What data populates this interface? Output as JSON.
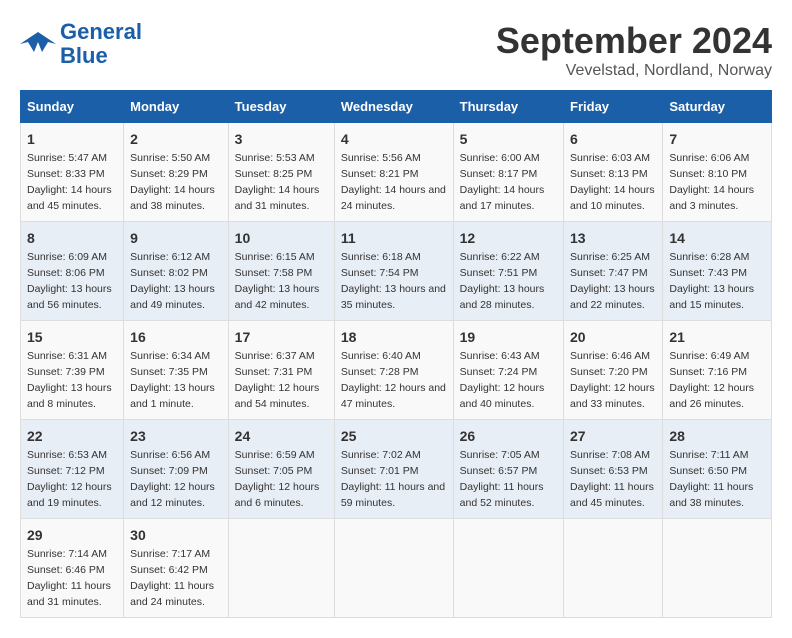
{
  "header": {
    "logo_general": "General",
    "logo_blue": "Blue",
    "month_title": "September 2024",
    "location": "Vevelstad, Nordland, Norway"
  },
  "columns": [
    "Sunday",
    "Monday",
    "Tuesday",
    "Wednesday",
    "Thursday",
    "Friday",
    "Saturday"
  ],
  "weeks": [
    [
      {
        "day": "1",
        "sunrise": "Sunrise: 5:47 AM",
        "sunset": "Sunset: 8:33 PM",
        "daylight": "Daylight: 14 hours and 45 minutes."
      },
      {
        "day": "2",
        "sunrise": "Sunrise: 5:50 AM",
        "sunset": "Sunset: 8:29 PM",
        "daylight": "Daylight: 14 hours and 38 minutes."
      },
      {
        "day": "3",
        "sunrise": "Sunrise: 5:53 AM",
        "sunset": "Sunset: 8:25 PM",
        "daylight": "Daylight: 14 hours and 31 minutes."
      },
      {
        "day": "4",
        "sunrise": "Sunrise: 5:56 AM",
        "sunset": "Sunset: 8:21 PM",
        "daylight": "Daylight: 14 hours and 24 minutes."
      },
      {
        "day": "5",
        "sunrise": "Sunrise: 6:00 AM",
        "sunset": "Sunset: 8:17 PM",
        "daylight": "Daylight: 14 hours and 17 minutes."
      },
      {
        "day": "6",
        "sunrise": "Sunrise: 6:03 AM",
        "sunset": "Sunset: 8:13 PM",
        "daylight": "Daylight: 14 hours and 10 minutes."
      },
      {
        "day": "7",
        "sunrise": "Sunrise: 6:06 AM",
        "sunset": "Sunset: 8:10 PM",
        "daylight": "Daylight: 14 hours and 3 minutes."
      }
    ],
    [
      {
        "day": "8",
        "sunrise": "Sunrise: 6:09 AM",
        "sunset": "Sunset: 8:06 PM",
        "daylight": "Daylight: 13 hours and 56 minutes."
      },
      {
        "day": "9",
        "sunrise": "Sunrise: 6:12 AM",
        "sunset": "Sunset: 8:02 PM",
        "daylight": "Daylight: 13 hours and 49 minutes."
      },
      {
        "day": "10",
        "sunrise": "Sunrise: 6:15 AM",
        "sunset": "Sunset: 7:58 PM",
        "daylight": "Daylight: 13 hours and 42 minutes."
      },
      {
        "day": "11",
        "sunrise": "Sunrise: 6:18 AM",
        "sunset": "Sunset: 7:54 PM",
        "daylight": "Daylight: 13 hours and 35 minutes."
      },
      {
        "day": "12",
        "sunrise": "Sunrise: 6:22 AM",
        "sunset": "Sunset: 7:51 PM",
        "daylight": "Daylight: 13 hours and 28 minutes."
      },
      {
        "day": "13",
        "sunrise": "Sunrise: 6:25 AM",
        "sunset": "Sunset: 7:47 PM",
        "daylight": "Daylight: 13 hours and 22 minutes."
      },
      {
        "day": "14",
        "sunrise": "Sunrise: 6:28 AM",
        "sunset": "Sunset: 7:43 PM",
        "daylight": "Daylight: 13 hours and 15 minutes."
      }
    ],
    [
      {
        "day": "15",
        "sunrise": "Sunrise: 6:31 AM",
        "sunset": "Sunset: 7:39 PM",
        "daylight": "Daylight: 13 hours and 8 minutes."
      },
      {
        "day": "16",
        "sunrise": "Sunrise: 6:34 AM",
        "sunset": "Sunset: 7:35 PM",
        "daylight": "Daylight: 13 hours and 1 minute."
      },
      {
        "day": "17",
        "sunrise": "Sunrise: 6:37 AM",
        "sunset": "Sunset: 7:31 PM",
        "daylight": "Daylight: 12 hours and 54 minutes."
      },
      {
        "day": "18",
        "sunrise": "Sunrise: 6:40 AM",
        "sunset": "Sunset: 7:28 PM",
        "daylight": "Daylight: 12 hours and 47 minutes."
      },
      {
        "day": "19",
        "sunrise": "Sunrise: 6:43 AM",
        "sunset": "Sunset: 7:24 PM",
        "daylight": "Daylight: 12 hours and 40 minutes."
      },
      {
        "day": "20",
        "sunrise": "Sunrise: 6:46 AM",
        "sunset": "Sunset: 7:20 PM",
        "daylight": "Daylight: 12 hours and 33 minutes."
      },
      {
        "day": "21",
        "sunrise": "Sunrise: 6:49 AM",
        "sunset": "Sunset: 7:16 PM",
        "daylight": "Daylight: 12 hours and 26 minutes."
      }
    ],
    [
      {
        "day": "22",
        "sunrise": "Sunrise: 6:53 AM",
        "sunset": "Sunset: 7:12 PM",
        "daylight": "Daylight: 12 hours and 19 minutes."
      },
      {
        "day": "23",
        "sunrise": "Sunrise: 6:56 AM",
        "sunset": "Sunset: 7:09 PM",
        "daylight": "Daylight: 12 hours and 12 minutes."
      },
      {
        "day": "24",
        "sunrise": "Sunrise: 6:59 AM",
        "sunset": "Sunset: 7:05 PM",
        "daylight": "Daylight: 12 hours and 6 minutes."
      },
      {
        "day": "25",
        "sunrise": "Sunrise: 7:02 AM",
        "sunset": "Sunset: 7:01 PM",
        "daylight": "Daylight: 11 hours and 59 minutes."
      },
      {
        "day": "26",
        "sunrise": "Sunrise: 7:05 AM",
        "sunset": "Sunset: 6:57 PM",
        "daylight": "Daylight: 11 hours and 52 minutes."
      },
      {
        "day": "27",
        "sunrise": "Sunrise: 7:08 AM",
        "sunset": "Sunset: 6:53 PM",
        "daylight": "Daylight: 11 hours and 45 minutes."
      },
      {
        "day": "28",
        "sunrise": "Sunrise: 7:11 AM",
        "sunset": "Sunset: 6:50 PM",
        "daylight": "Daylight: 11 hours and 38 minutes."
      }
    ],
    [
      {
        "day": "29",
        "sunrise": "Sunrise: 7:14 AM",
        "sunset": "Sunset: 6:46 PM",
        "daylight": "Daylight: 11 hours and 31 minutes."
      },
      {
        "day": "30",
        "sunrise": "Sunrise: 7:17 AM",
        "sunset": "Sunset: 6:42 PM",
        "daylight": "Daylight: 11 hours and 24 minutes."
      },
      {
        "day": "",
        "sunrise": "",
        "sunset": "",
        "daylight": ""
      },
      {
        "day": "",
        "sunrise": "",
        "sunset": "",
        "daylight": ""
      },
      {
        "day": "",
        "sunrise": "",
        "sunset": "",
        "daylight": ""
      },
      {
        "day": "",
        "sunrise": "",
        "sunset": "",
        "daylight": ""
      },
      {
        "day": "",
        "sunrise": "",
        "sunset": "",
        "daylight": ""
      }
    ]
  ]
}
